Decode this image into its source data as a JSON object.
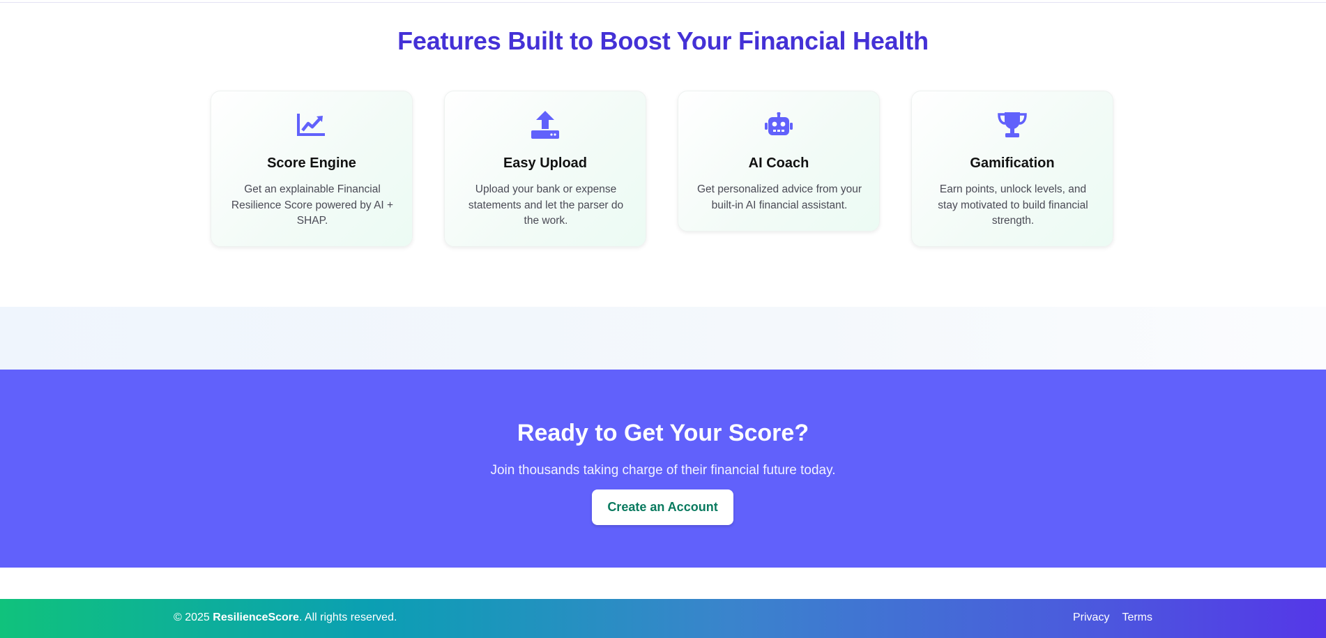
{
  "features": {
    "title": "Features Built to Boost Your Financial Health",
    "cards": [
      {
        "icon": "chart-line-icon",
        "title": "Score Engine",
        "description": "Get an explainable Financial Resilience Score powered by AI + SHAP."
      },
      {
        "icon": "upload-icon",
        "title": "Easy Upload",
        "description": "Upload your bank or expense statements and let the parser do the work."
      },
      {
        "icon": "robot-icon",
        "title": "AI Coach",
        "description": "Get personalized advice from your built-in AI financial assistant."
      },
      {
        "icon": "trophy-icon",
        "title": "Gamification",
        "description": "Earn points, unlock levels, and stay motivated to build financial strength."
      }
    ]
  },
  "cta": {
    "title": "Ready to Get Your Score?",
    "subtitle": "Join thousands taking charge of their financial future today.",
    "button_label": "Create an Account"
  },
  "footer": {
    "copyright_prefix": "© 2025 ",
    "brand": "ResilienceScore",
    "copyright_suffix": ". All rights reserved.",
    "links": [
      "Privacy",
      "Terms"
    ]
  },
  "colors": {
    "accent": "#4431d6",
    "icon": "#6161fb",
    "cta_background": "#6161fb",
    "cta_button_text": "#0a7a5f",
    "footer_gradient_start": "#10c27c",
    "footer_gradient_end": "#5537e8"
  }
}
